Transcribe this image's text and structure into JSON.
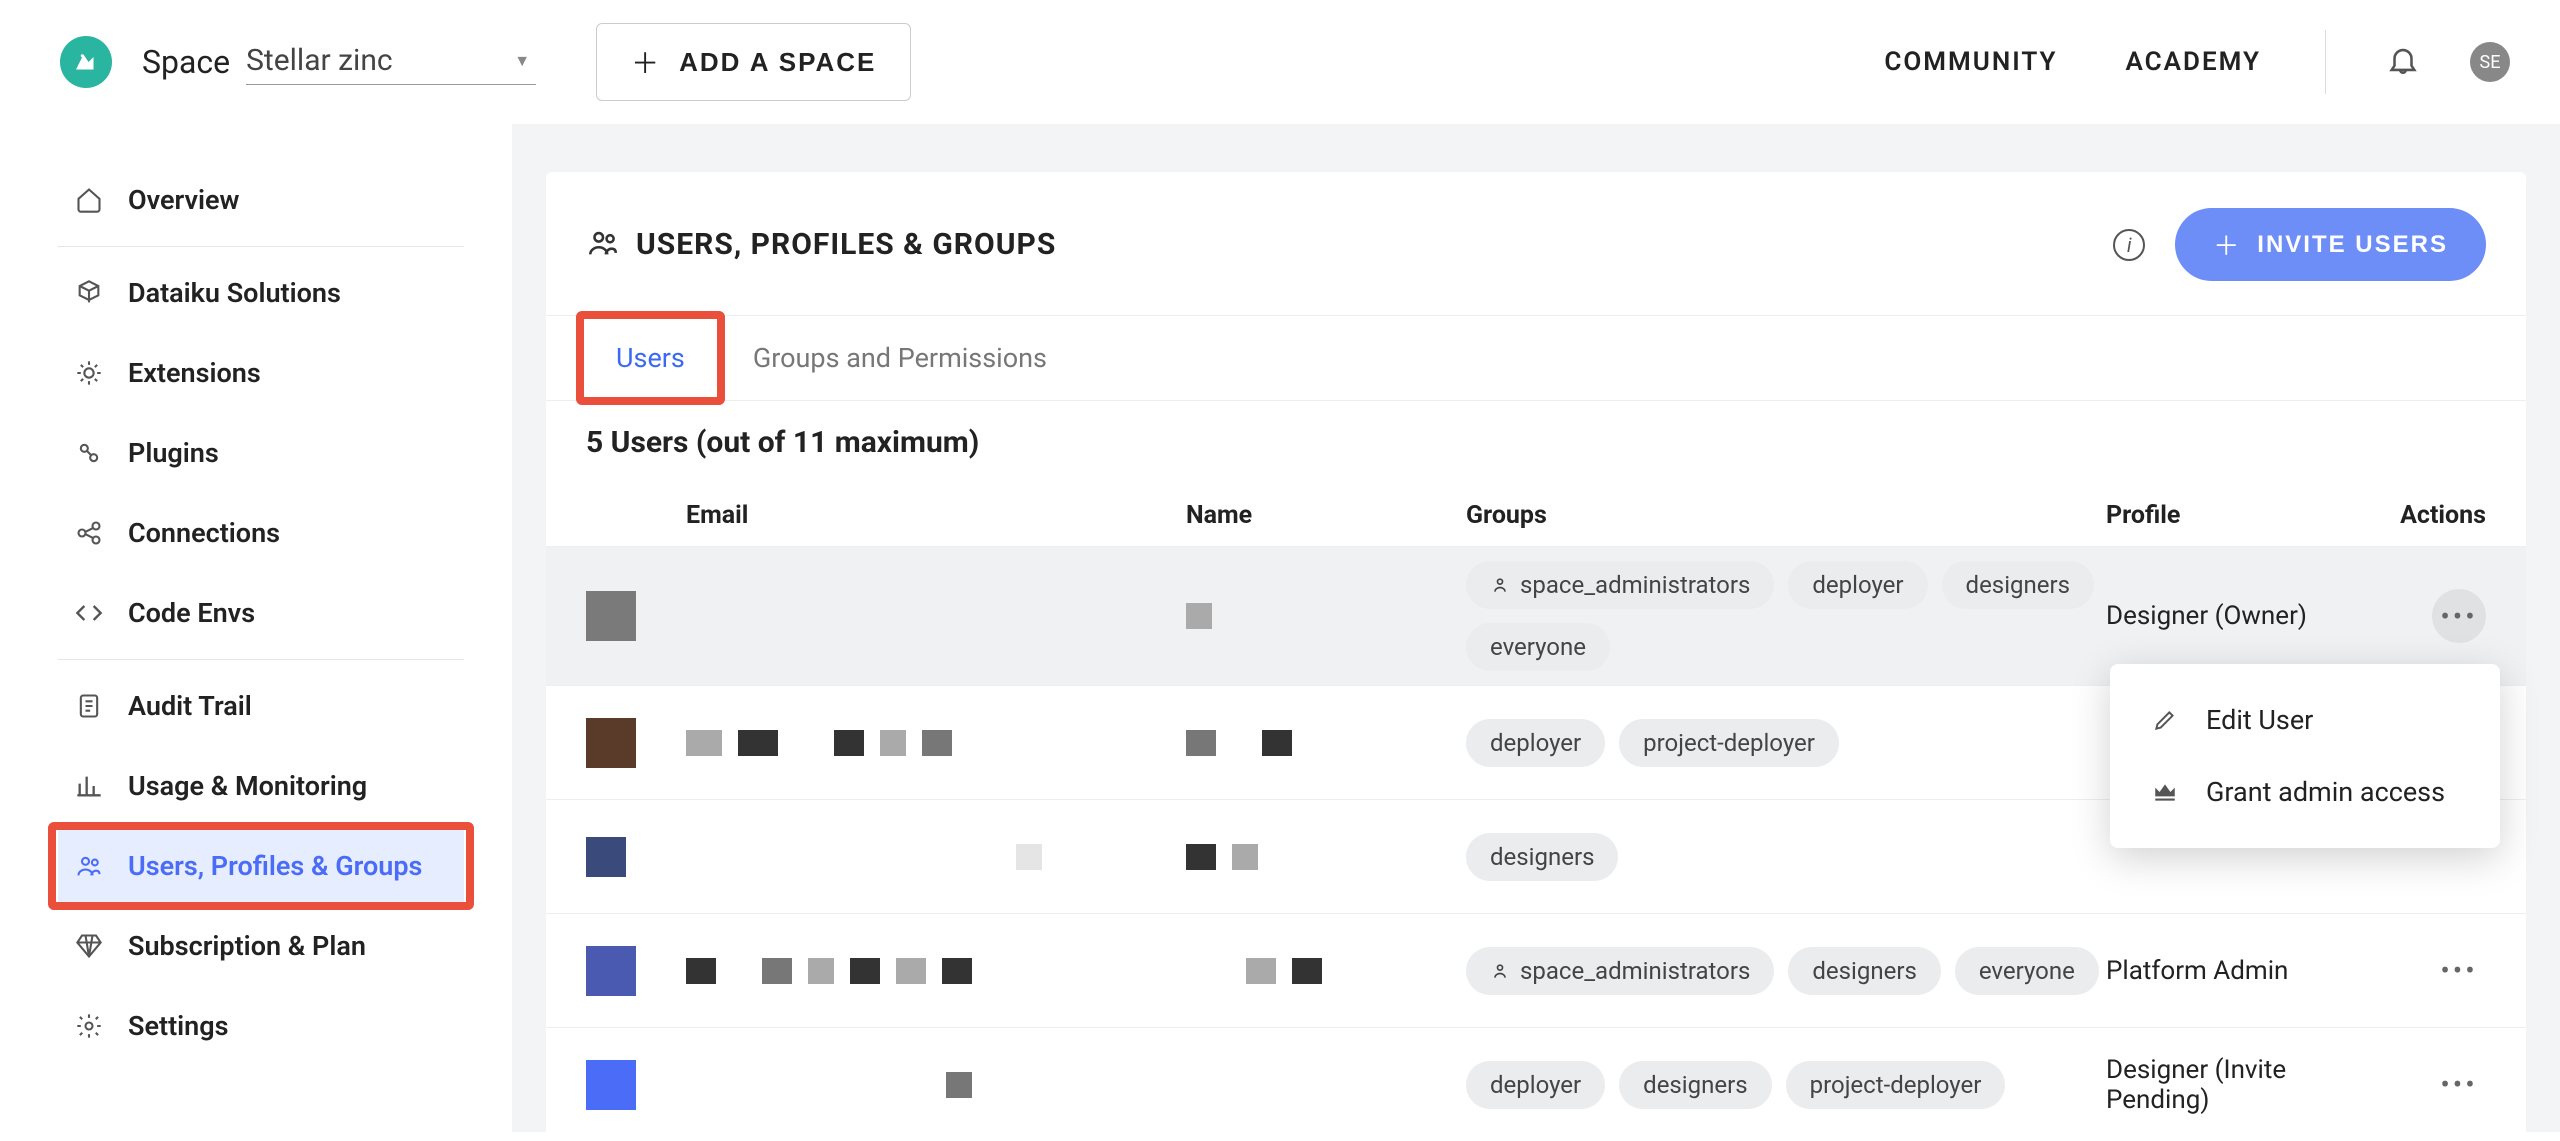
{
  "topbar": {
    "space_label": "Space",
    "space_value": "Stellar zinc",
    "add_space": "ADD A SPACE",
    "community": "COMMUNITY",
    "academy": "ACADEMY",
    "avatar_initials": "SE"
  },
  "sidebar": {
    "items": [
      {
        "label": "Overview"
      },
      {
        "label": "Dataiku Solutions"
      },
      {
        "label": "Extensions"
      },
      {
        "label": "Plugins"
      },
      {
        "label": "Connections"
      },
      {
        "label": "Code Envs"
      },
      {
        "label": "Audit Trail"
      },
      {
        "label": "Usage & Monitoring"
      },
      {
        "label": "Users, Profiles & Groups"
      },
      {
        "label": "Subscription & Plan"
      },
      {
        "label": "Settings"
      }
    ]
  },
  "panel": {
    "title": "USERS, PROFILES & GROUPS",
    "invite": "INVITE USERS",
    "tabs": {
      "users": "Users",
      "groups": "Groups and Permissions"
    },
    "count_text": "5 Users (out of 11 maximum)",
    "columns": {
      "email": "Email",
      "name": "Name",
      "groups": "Groups",
      "profile": "Profile",
      "actions": "Actions"
    },
    "rows": [
      {
        "groups": [
          "space_administrators",
          "deployer",
          "designers",
          "everyone"
        ],
        "group_icons": [
          true,
          false,
          false,
          false
        ],
        "profile": "Designer (Owner)",
        "highlight": true,
        "menu_open": true
      },
      {
        "groups": [
          "deployer",
          "project-deployer"
        ],
        "group_icons": [
          false,
          false
        ],
        "profile": "",
        "highlight": false
      },
      {
        "groups": [
          "designers"
        ],
        "group_icons": [
          false
        ],
        "profile": "",
        "highlight": false
      },
      {
        "groups": [
          "space_administrators",
          "designers",
          "everyone"
        ],
        "group_icons": [
          true,
          false,
          false
        ],
        "profile": "Platform Admin",
        "highlight": false
      },
      {
        "groups": [
          "deployer",
          "designers",
          "project-deployer"
        ],
        "group_icons": [
          false,
          false,
          false
        ],
        "profile": "Designer (Invite Pending)",
        "highlight": false
      }
    ],
    "menu": {
      "edit": "Edit User",
      "grant": "Grant admin access"
    }
  }
}
